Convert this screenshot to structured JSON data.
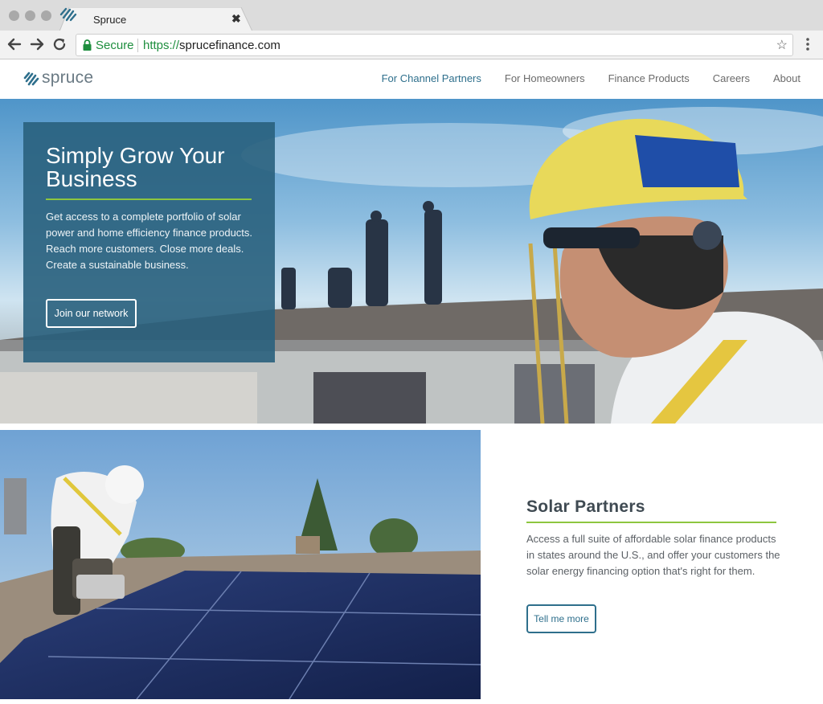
{
  "browser": {
    "tab_title": "Spruce",
    "tab_close": "✖",
    "secure_label": "Secure",
    "url_scheme": "https://",
    "url_host": "sprucefinance.com",
    "star": "☆",
    "secure_color": "#1e8e3e"
  },
  "site": {
    "logo_text": "spruce",
    "nav": [
      {
        "label": "For Channel Partners",
        "active": true
      },
      {
        "label": "For Homeowners"
      },
      {
        "label": "Finance Products"
      },
      {
        "label": "Careers"
      },
      {
        "label": "About"
      }
    ],
    "brand_color": "#2e6f8c",
    "accent_color": "#8dc63f"
  },
  "hero": {
    "title": "Simply Grow Your Business",
    "body": "Get access to a complete portfolio of solar power and home efficiency finance products. Reach more customers. Close more deals. Create a sustainable business.",
    "cta": "Join our network"
  },
  "solar_partners": {
    "title": "Solar Partners",
    "body": "Access a full suite of affordable solar finance products in states around the U.S., and offer your customers the solar energy financing option that's right for them.",
    "cta": "Tell me more"
  }
}
